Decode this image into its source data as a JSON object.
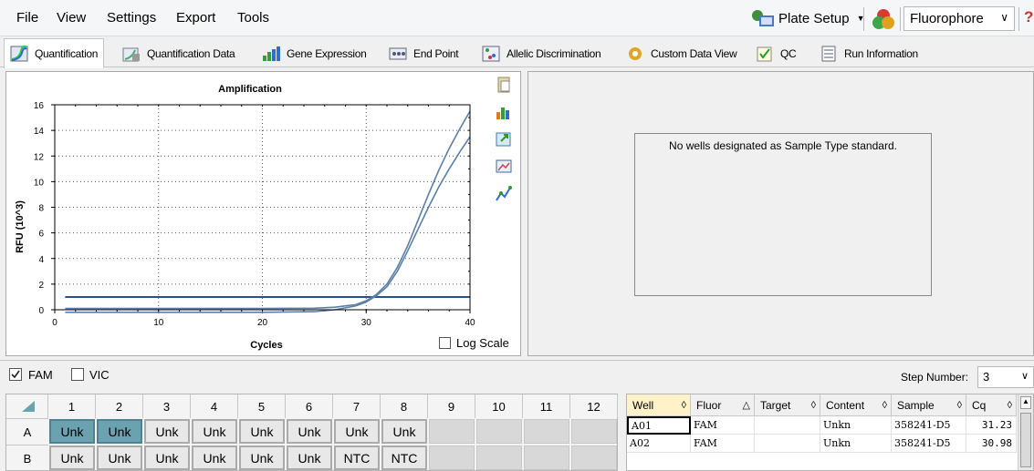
{
  "menu": [
    "File",
    "View",
    "Settings",
    "Export",
    "Tools"
  ],
  "toolbar": {
    "plate_setup": "Plate Setup",
    "fluorophore": "Fluorophore",
    "help": "?"
  },
  "tabs": [
    "Quantification",
    "Quantification Data",
    "Gene Expression",
    "End Point",
    "Allelic Discrimination",
    "Custom Data View",
    "QC",
    "Run Information"
  ],
  "active_tab": "Quantification",
  "chart_data": {
    "type": "line",
    "title": "Amplification",
    "xlabel": "Cycles",
    "ylabel": "RFU (10^3)",
    "xlim": [
      0,
      40
    ],
    "ylim": [
      0,
      16
    ],
    "x_ticks": [
      0,
      10,
      20,
      30,
      40
    ],
    "y_ticks": [
      0,
      2,
      4,
      6,
      8,
      10,
      12,
      14,
      16
    ],
    "grid": true,
    "threshold": 1.0,
    "series": [
      {
        "x": [
          1,
          5,
          10,
          15,
          20,
          25,
          27,
          29,
          30,
          31,
          32,
          33,
          34,
          35,
          36,
          37,
          38,
          39,
          40
        ],
        "values": [
          0.1,
          0.1,
          0.1,
          0.1,
          0.1,
          0.12,
          0.2,
          0.4,
          0.7,
          1.2,
          2.0,
          3.3,
          5.0,
          7.0,
          9.0,
          10.9,
          12.6,
          14.1,
          15.5
        ]
      },
      {
        "x": [
          1,
          5,
          10,
          15,
          20,
          25,
          27,
          29,
          30,
          31,
          32,
          33,
          34,
          35,
          36,
          37,
          38,
          39,
          40
        ],
        "values": [
          -0.2,
          -0.2,
          -0.2,
          -0.2,
          -0.2,
          -0.15,
          0.0,
          0.3,
          0.6,
          1.1,
          1.8,
          3.0,
          4.6,
          6.3,
          8.0,
          9.6,
          11.0,
          12.3,
          13.5
        ]
      }
    ]
  },
  "log_scale_label": "Log Scale",
  "no_wells_msg": "No wells designated as Sample Type standard.",
  "channels": [
    {
      "label": "FAM",
      "checked": true
    },
    {
      "label": "VIC",
      "checked": false
    }
  ],
  "step_number": {
    "label": "Step Number:",
    "value": "3"
  },
  "plate": {
    "columns": [
      "1",
      "2",
      "3",
      "4",
      "5",
      "6",
      "7",
      "8",
      "9",
      "10",
      "11",
      "12"
    ],
    "rows": [
      {
        "label": "A",
        "wells": [
          "Unk",
          "Unk",
          "Unk",
          "Unk",
          "Unk",
          "Unk",
          "Unk",
          "Unk",
          "",
          "",
          "",
          ""
        ]
      },
      {
        "label": "B",
        "wells": [
          "Unk",
          "Unk",
          "Unk",
          "Unk",
          "Unk",
          "Unk",
          "NTC",
          "NTC",
          "",
          "",
          "",
          ""
        ]
      }
    ]
  },
  "table": {
    "headers": [
      "Well",
      "Fluor",
      "Target",
      "Content",
      "Sample",
      "Cq"
    ],
    "rows": [
      [
        "A01",
        "FAM",
        "",
        "Unkn",
        "358241-D5",
        "31.23"
      ],
      [
        "A02",
        "FAM",
        "",
        "Unkn",
        "358241-D5",
        "30.98"
      ]
    ]
  },
  "colors": {
    "selected_well": "#6aa2b0",
    "curve": "#5b7fa6",
    "threshold": "#2f4f8a"
  }
}
